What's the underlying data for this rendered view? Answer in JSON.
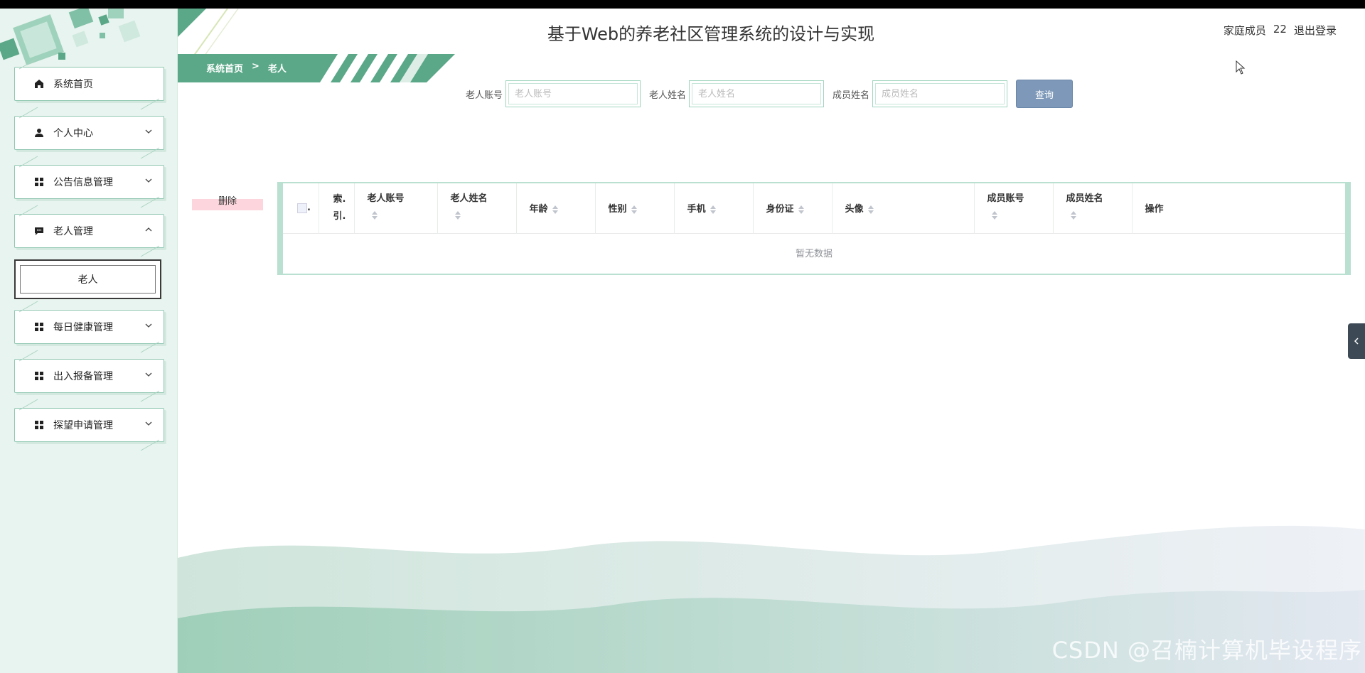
{
  "header": {
    "title": "基于Web的养老社区管理系统的设计与实现",
    "user_label": "家庭成员",
    "user_name": "22",
    "logout": "退出登录"
  },
  "sidebar": {
    "items": [
      {
        "label": "系统首页",
        "icon": "home-icon"
      },
      {
        "label": "个人中心",
        "icon": "person-icon"
      },
      {
        "label": "公告信息管理",
        "icon": "grid-icon"
      },
      {
        "label": "老人管理",
        "icon": "chat-icon"
      },
      {
        "label": "每日健康管理",
        "icon": "grid-icon"
      },
      {
        "label": "出入报备管理",
        "icon": "grid-icon"
      },
      {
        "label": "探望申请管理",
        "icon": "grid-icon"
      }
    ],
    "submenu": {
      "label": "老人"
    }
  },
  "breadcrumb": {
    "home": "系统首页",
    "separator": ">",
    "current": "老人"
  },
  "search": {
    "fields": [
      {
        "label": "老人账号",
        "placeholder": "老人账号",
        "value": ""
      },
      {
        "label": "老人姓名",
        "placeholder": "老人姓名",
        "value": ""
      },
      {
        "label": "成员姓名",
        "placeholder": "成员姓名",
        "value": ""
      }
    ],
    "query_button": "查询"
  },
  "actions": {
    "delete": "删除"
  },
  "table": {
    "columns": [
      "索引",
      "老人账号",
      "老人姓名",
      "年龄",
      "性别",
      "手机",
      "身份证",
      "头像",
      "成员账号",
      "成员姓名",
      "操作"
    ],
    "index_col_line1": "索.",
    "index_col_line2": "引.",
    "empty_text": "暂无数据"
  },
  "watermark": "CSDN @召楠计算机毕设程序",
  "colors": {
    "accent_green": "#5aa888",
    "sidebar_bg": "#e8f4ef",
    "query_button": "#7d98b8",
    "delete_highlight": "#fcd6dc"
  }
}
